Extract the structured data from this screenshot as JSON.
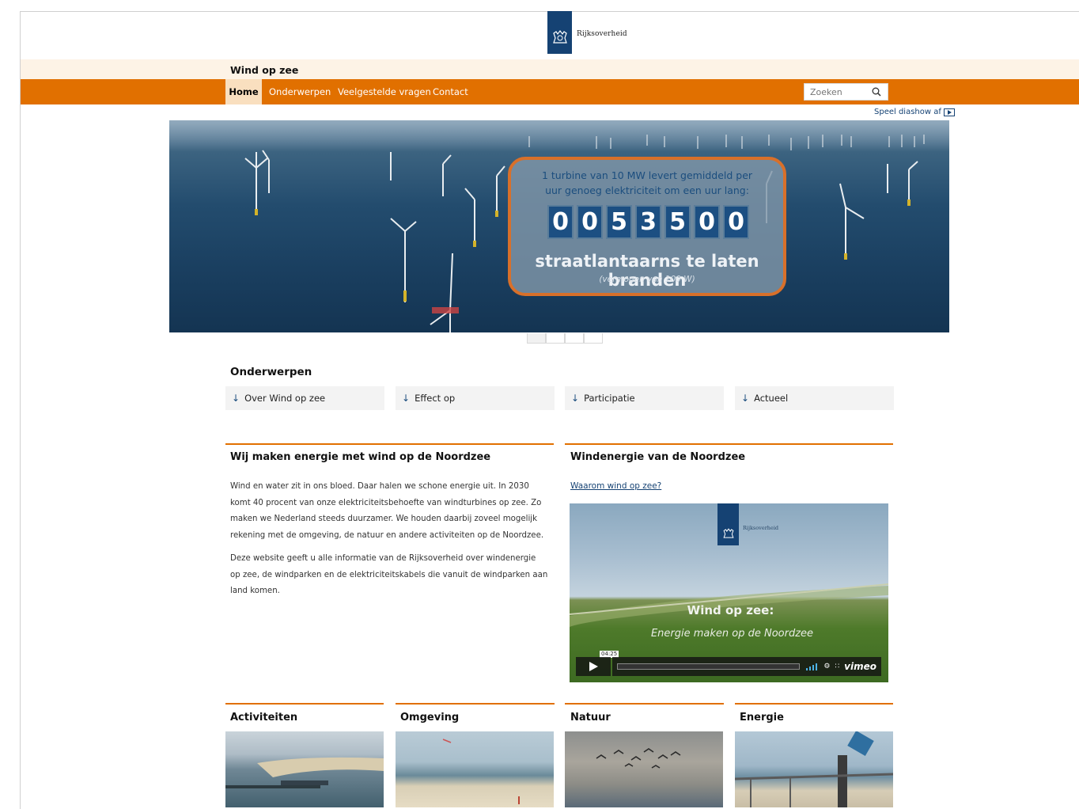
{
  "header": {
    "logo_text": "Rijksoverheid",
    "site_title": "Wind op zee"
  },
  "nav": {
    "items": [
      "Home",
      "Onderwerpen",
      "Veelgestelde vragen",
      "Contact"
    ],
    "active": "Home",
    "search_placeholder": "Zoeken",
    "slideshow_label": "Speel diashow af"
  },
  "hero": {
    "line1": "1 turbine van 10 MW levert gemiddeld per",
    "line2": "uur genoeg elektriciteit om een uur lang:",
    "counter": [
      "0",
      "0",
      "5",
      "3",
      "5",
      "0",
      "0"
    ],
    "big_text": "straatlantaarns te laten branden",
    "small_text": "(vermogen van 100 W)",
    "slides": 4,
    "active_slide": 1
  },
  "topics": {
    "heading": "Onderwerpen",
    "items": [
      "Over Wind op zee",
      "Effect op",
      "Participatie",
      "Actueel"
    ]
  },
  "intro": {
    "title": "Wij maken energie met wind op de Noordzee",
    "paragraphs": [
      [
        "Wind en water zit in ons bloed. Daar halen we schone energie uit. In 2030",
        "komt 40 procent van onze elektriciteitsbehoefte van windturbines op zee. Zo",
        "maken we Nederland steeds duurzamer. We houden daarbij zoveel mogelijk",
        "rekening met de omgeving, de natuur en andere activiteiten op de Noordzee."
      ],
      [
        "Deze website geeft u alle informatie van de Rijksoverheid over windenergie",
        "op zee, de windparken en de elektriciteitskabels die vanuit de windparken aan",
        "land komen."
      ]
    ]
  },
  "video_block": {
    "title": "Windenergie van de Noordzee",
    "link": "Waarom wind op zee?",
    "video_logo_text": "Rijksoverheid",
    "video_title": "Wind op zee:",
    "video_subtitle": "Energie maken op de Noordzee",
    "duration": "04:25",
    "player_brand": "vimeo"
  },
  "tiles": [
    "Activiteiten",
    "Omgeving",
    "Natuur",
    "Energie"
  ],
  "colors": {
    "accent_orange": "#e17000",
    "title_band": "#fdf3e6",
    "brand_blue": "#154273"
  }
}
